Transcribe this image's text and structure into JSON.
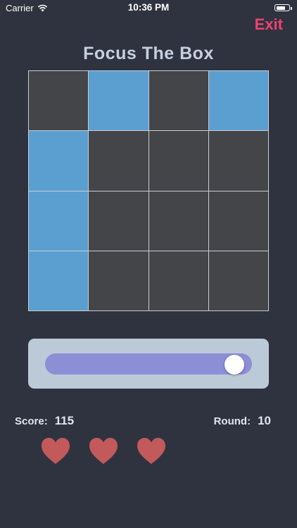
{
  "status_bar": {
    "carrier": "Carrier",
    "time": "10:36 PM",
    "battery_level": 0.75
  },
  "header": {
    "exit_label": "Exit",
    "title": "Focus The Box"
  },
  "board": {
    "rows": 4,
    "columns": 4,
    "lit_color": "#5a9fd0",
    "dark_color": "#434548",
    "cells": [
      [
        false,
        true,
        false,
        true
      ],
      [
        true,
        false,
        false,
        false
      ],
      [
        true,
        false,
        false,
        false
      ],
      [
        true,
        false,
        false,
        false
      ]
    ]
  },
  "slider": {
    "value": 0.96,
    "track_color": "#8c8fd6"
  },
  "stats": {
    "score_label": "Score:",
    "score_value": "115",
    "round_label": "Round:",
    "round_value": "10"
  },
  "lives": {
    "count": 3,
    "heart_color": "#c2595b"
  },
  "colors": {
    "background": "#2f3340",
    "accent": "#f1416c"
  }
}
